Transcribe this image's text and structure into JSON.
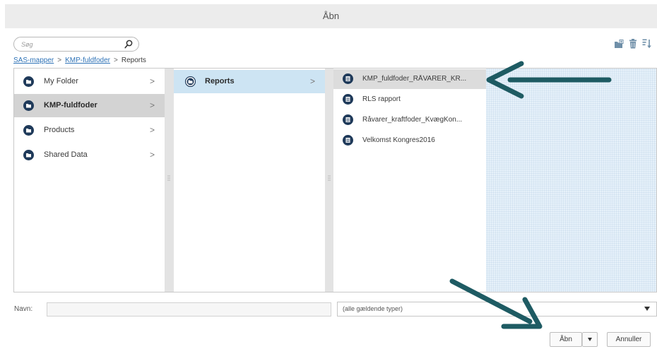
{
  "window": {
    "title": "Åbn"
  },
  "search": {
    "placeholder": "Søg",
    "icon": "magnifier-icon"
  },
  "toolbar": {
    "icons": [
      "new-folder-icon",
      "delete-icon",
      "sort-icon"
    ]
  },
  "breadcrumb": {
    "items": [
      "SAS-mapper",
      "KMP-fuldfoder",
      "Reports"
    ],
    "separator": ">"
  },
  "columns": {
    "folders": [
      {
        "label": "My Folder",
        "chevron": ">",
        "state": "normal"
      },
      {
        "label": "KMP-fuldfoder",
        "chevron": ">",
        "state": "selected"
      },
      {
        "label": "Products",
        "chevron": ">",
        "state": "normal"
      },
      {
        "label": "Shared Data",
        "chevron": ">",
        "state": "normal"
      }
    ],
    "subfolders": [
      {
        "label": "Reports",
        "chevron": ">",
        "state": "active"
      }
    ],
    "files": [
      {
        "label": "KMP_fuldfoder_RÅVARER_KR...",
        "state": "selected"
      },
      {
        "label": "RLS rapport",
        "state": "normal"
      },
      {
        "label": "Råvarer_kraftfoder_KvægKon...",
        "state": "normal"
      },
      {
        "label": "Velkomst Kongres2016",
        "state": "normal"
      }
    ]
  },
  "footer": {
    "name_label": "Navn:",
    "name_value": "",
    "type_value": "(alle gældende typer)",
    "open_label": "Åbn",
    "cancel_label": "Annuller"
  },
  "colors": {
    "accent_blue": "#cde4f3",
    "selection_gray": "#d3d3d3",
    "icon_navy": "#1f3a5a",
    "annotation_arrow": "#1e5b63",
    "link": "#2f73b7"
  }
}
